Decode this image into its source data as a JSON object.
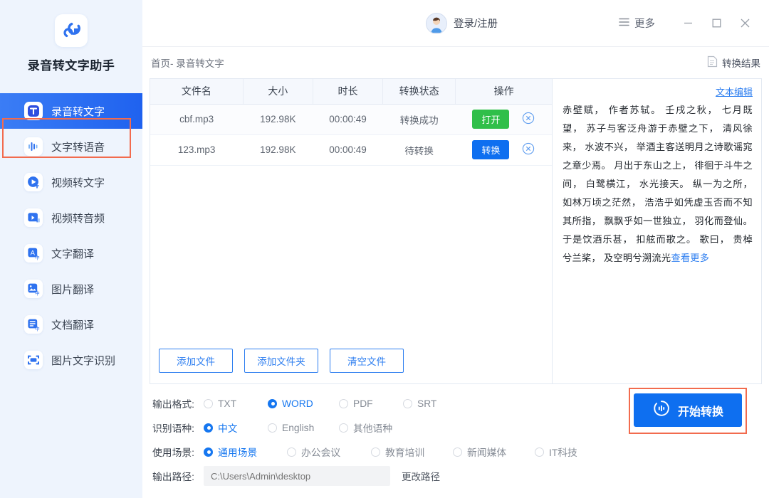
{
  "app": {
    "title": "录音转文字助手",
    "logo_icon": "app-logo-icon"
  },
  "sidebar": {
    "items": [
      {
        "label": "录音转文字",
        "icon": "audio-to-text-icon",
        "active": true
      },
      {
        "label": "文字转语音",
        "icon": "text-to-speech-icon",
        "active": false
      },
      {
        "label": "视频转文字",
        "icon": "video-to-text-icon",
        "active": false
      },
      {
        "label": "视频转音频",
        "icon": "video-to-audio-icon",
        "active": false
      },
      {
        "label": "文字翻译",
        "icon": "text-translate-icon",
        "active": false
      },
      {
        "label": "图片翻译",
        "icon": "image-translate-icon",
        "active": false
      },
      {
        "label": "文档翻译",
        "icon": "doc-translate-icon",
        "active": false
      },
      {
        "label": "图片文字识别",
        "icon": "image-ocr-icon",
        "active": false
      }
    ]
  },
  "topbar": {
    "account_label": "登录/注册",
    "avatar_icon": "user-avatar-icon",
    "more_label": "更多",
    "more_icon": "hamburger-icon",
    "minimize_icon": "minimize-icon",
    "maximize_icon": "maximize-icon",
    "close_icon": "close-icon"
  },
  "breadcrumb": {
    "text": "首页- 录音转文字",
    "result_label": "转换结果",
    "result_icon": "document-icon"
  },
  "table": {
    "columns": [
      "文件名",
      "大小",
      "时长",
      "转换状态",
      "操作"
    ],
    "rows": [
      {
        "name": "cbf.mp3",
        "size": "192.98K",
        "duration": "00:00:49",
        "status": "转换成功",
        "action_label": "打开",
        "action_kind": "open",
        "delete_icon": "close-circle-icon"
      },
      {
        "name": "123.mp3",
        "size": "192.98K",
        "duration": "00:00:49",
        "status": "待转换",
        "action_label": "转换",
        "action_kind": "convert",
        "delete_icon": "close-circle-icon"
      }
    ]
  },
  "file_buttons": {
    "add_file": "添加文件",
    "add_folder": "添加文件夹",
    "clear_files": "清空文件"
  },
  "transcript": {
    "edit_label": "文本编辑",
    "body": "赤壁赋， 作者苏轼。 壬戌之秋， 七月既望， 苏子与客泛舟游于赤壁之下， 清风徐来， 水波不兴， 举酒主客送明月之诗歌谣窕之章少焉。 月出于东山之上， 徘徊于斗牛之间， 白鹭横江， 水光接天。 纵一为之所， 如林万顷之茫然， 浩浩乎如凭虚玉否而不知其所指， 飘飘乎如一世独立， 羽化而登仙。 于是饮酒乐甚， 扣舷而歌之。 歌曰， 贵棹兮兰桨， 及空明兮溯流光",
    "more_label": "查看更多"
  },
  "options": {
    "format": {
      "label": "输出格式:",
      "choices": [
        "TXT",
        "WORD",
        "PDF",
        "SRT"
      ],
      "selected": "WORD"
    },
    "language": {
      "label": "识别语种:",
      "choices": [
        "中文",
        "English",
        "其他语种"
      ],
      "selected": "中文"
    },
    "scene": {
      "label": "使用场景:",
      "choices": [
        "通用场景",
        "办公会议",
        "教育培训",
        "新闻媒体",
        "IT科技"
      ],
      "selected": "通用场景"
    },
    "path": {
      "label": "输出路径:",
      "value": "",
      "placeholder": "C:\\Users\\Admin\\desktop",
      "change_label": "更改路径"
    }
  },
  "start": {
    "label": "开始转换",
    "icon": "convert-circle-icon"
  },
  "colors": {
    "accent": "#0e6ff0",
    "sidebar_bg": "#eef4fd",
    "active_nav": "#2b6ef0",
    "success_green": "#30bf4a",
    "highlight_orange": "#f26b4e",
    "link_blue": "#2b7df0"
  }
}
